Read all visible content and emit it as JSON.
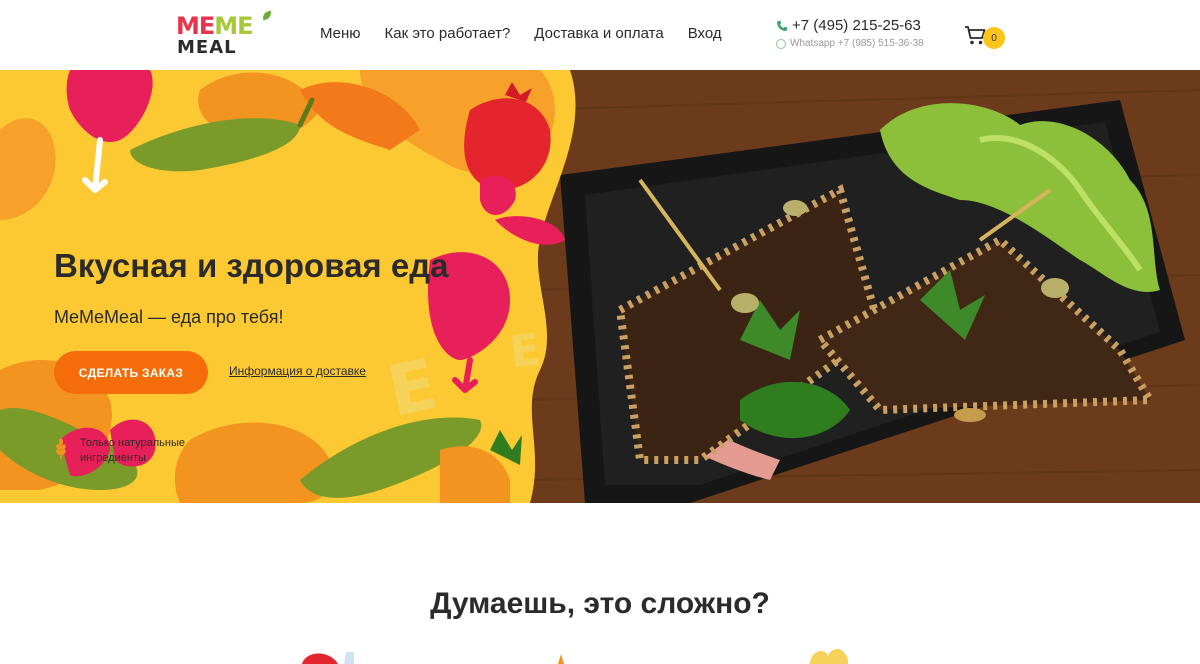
{
  "header": {
    "logo": {
      "line1": [
        "ME",
        "ME"
      ],
      "line2": "MEAL"
    },
    "nav": [
      "Меню",
      "Как это работает?",
      "Доставка и оплата",
      "Вход"
    ],
    "phone": "+7 (495) 215-25-63",
    "whatsapp": "Whatsapp +7 (985) 515-36-38",
    "cart_count": "0"
  },
  "hero": {
    "title": "Вкусная и здоровая еда",
    "subtitle": "MeMeMeal — еда про тебя!",
    "order_button": "СДЕЛАТЬ ЗАКАЗ",
    "delivery_link": "Информация о доставке",
    "feature": "Только натуральные ингредиенты"
  },
  "section": {
    "title": "Думаешь, это сложно?"
  },
  "colors": {
    "accent_orange": "#f56d0a",
    "badge_yellow": "#fdc41a",
    "hero_yellow": "#fdc932",
    "beet_pink": "#e8205a",
    "tomato_red": "#e5252e",
    "pepper_green": "#7a9a2a",
    "wood_brown": "#6e3e1d"
  },
  "icons": [
    "phone-icon",
    "whatsapp-icon",
    "cart-icon",
    "wheat-icon"
  ]
}
